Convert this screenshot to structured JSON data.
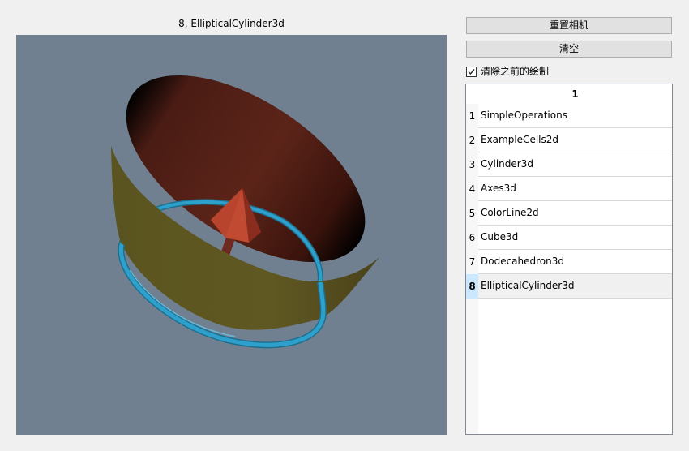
{
  "viewport": {
    "title": "8, EllipticalCylinder3d",
    "background": "#708090"
  },
  "controls": {
    "reset_camera_label": "重置相机",
    "clear_label": "清空",
    "clear_previous": {
      "label": "清除之前的绘制",
      "checked": true
    }
  },
  "list": {
    "column_header": "1",
    "selected_index": 8,
    "rows": [
      {
        "num": "1",
        "name": "SimpleOperations"
      },
      {
        "num": "2",
        "name": "ExampleCells2d"
      },
      {
        "num": "3",
        "name": "Cylinder3d"
      },
      {
        "num": "4",
        "name": "Axes3d"
      },
      {
        "num": "5",
        "name": "ColorLine2d"
      },
      {
        "num": "6",
        "name": "Cube3d"
      },
      {
        "num": "7",
        "name": "Dodecahedron3d"
      },
      {
        "num": "8",
        "name": "EllipticalCylinder3d"
      }
    ]
  },
  "colors": {
    "cylinder_inner": "#5a2218",
    "cylinder_outer": "#5e5622",
    "ring": "#2ea0cc",
    "cone": "#b2402c"
  }
}
